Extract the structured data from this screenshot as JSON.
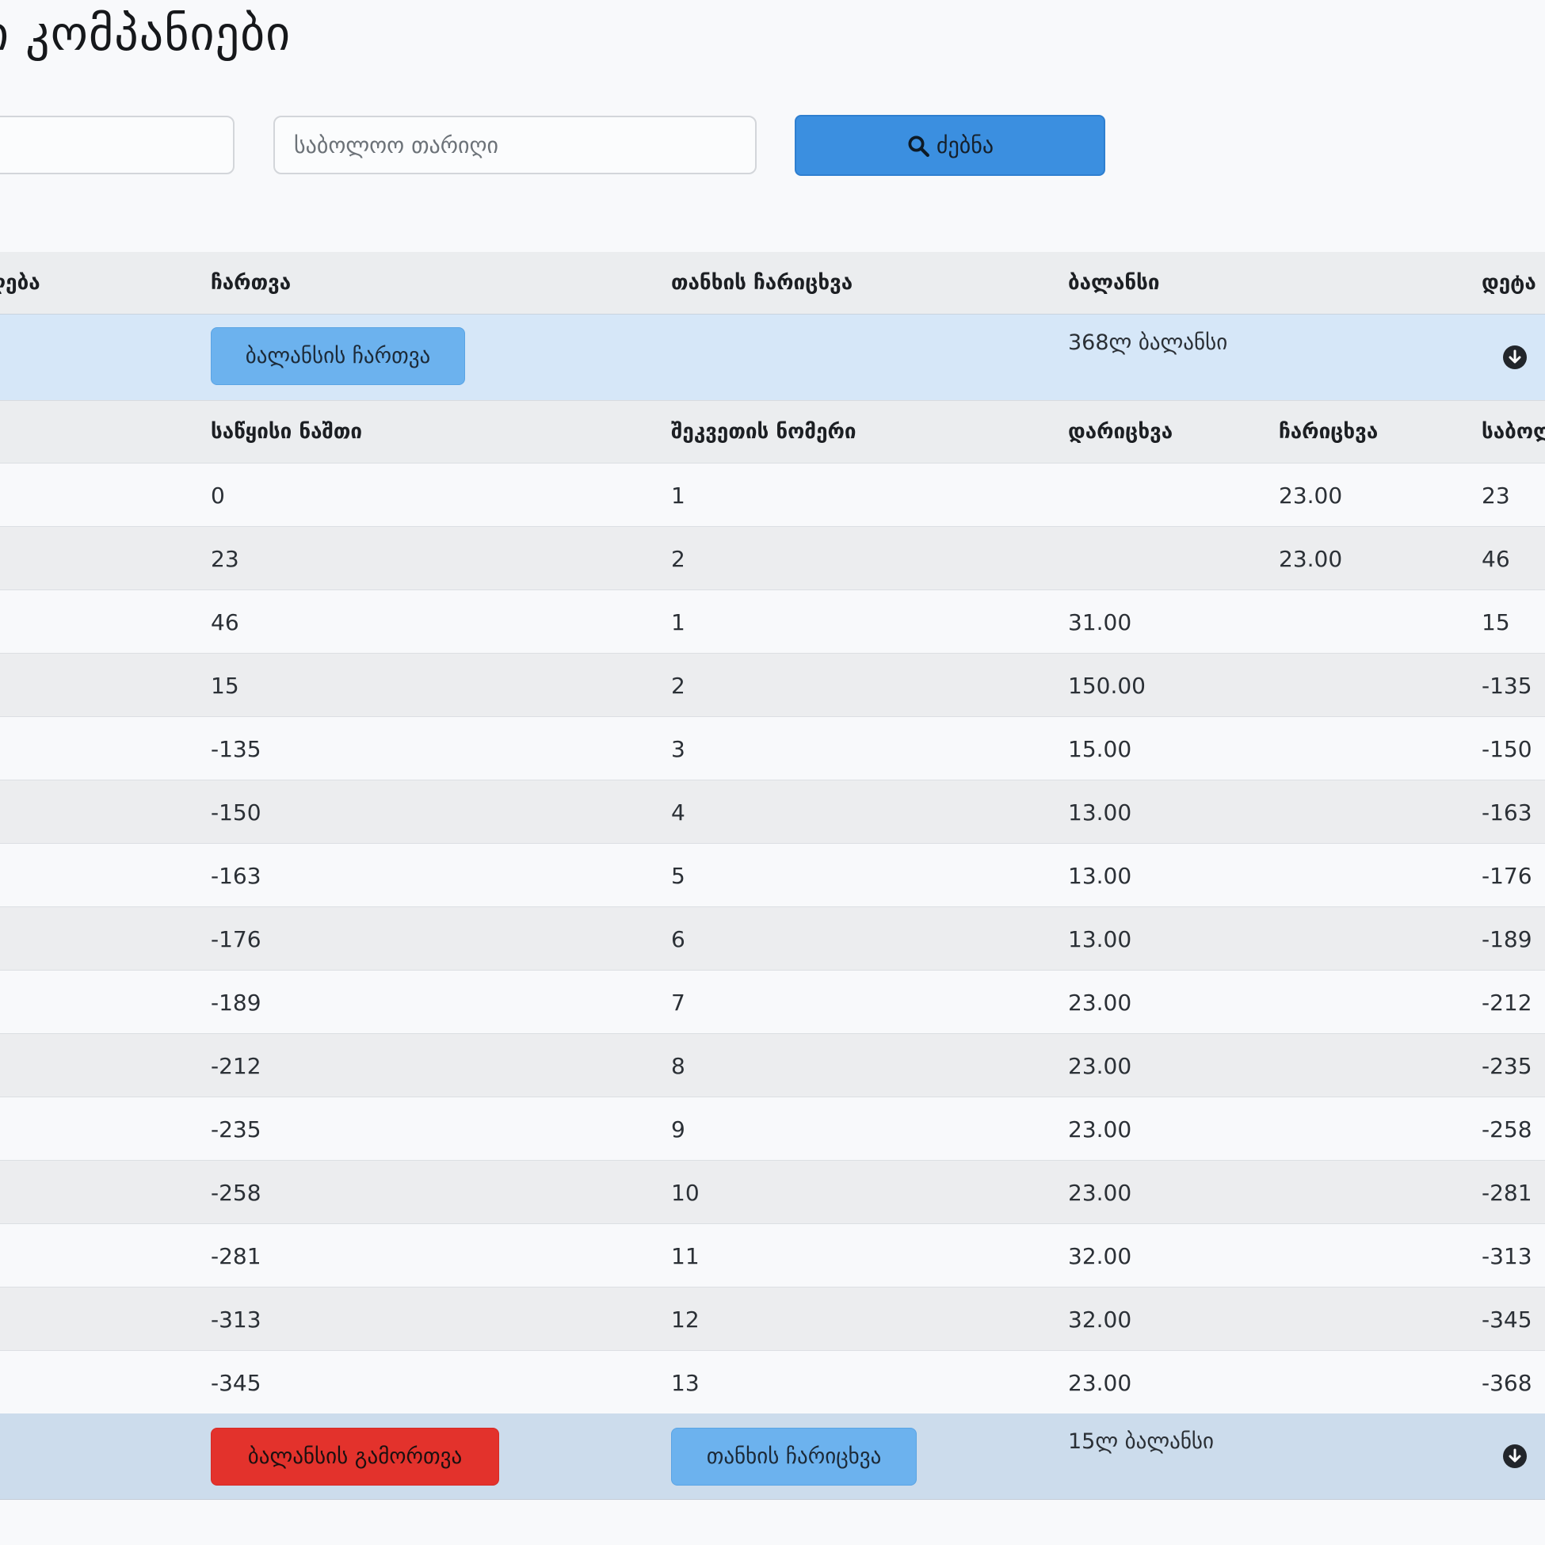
{
  "page": {
    "title": "ი კომპანიები"
  },
  "filters": {
    "start_date_value": "",
    "end_date_placeholder": "საბოლოო თარიღი",
    "search_label": "ძებნა"
  },
  "table": {
    "headers": {
      "col1": "ღება",
      "col2": "ჩართვა",
      "col3": "თანხის ჩარიცხვა",
      "col4": "ბალანსი",
      "col5": "დეტა"
    },
    "top_summary": {
      "activate_label": "ბალანსის ჩართვა",
      "balance_text": "368ლ ბალანსი"
    },
    "sub_headers": {
      "initial": "საწყისი ნაშთი",
      "order": "შეკვეთის ნომერი",
      "debit": "დარიცხვა",
      "credit": "ჩარიცხვა",
      "final": "საბოლ"
    },
    "rows": [
      {
        "initial": "0",
        "order": "1",
        "debit": "",
        "credit": "23.00",
        "final": "23"
      },
      {
        "initial": "23",
        "order": "2",
        "debit": "",
        "credit": "23.00",
        "final": "46"
      },
      {
        "initial": "46",
        "order": "1",
        "debit": "31.00",
        "credit": "",
        "final": "15"
      },
      {
        "initial": "15",
        "order": "2",
        "debit": "150.00",
        "credit": "",
        "final": "-135"
      },
      {
        "initial": "-135",
        "order": "3",
        "debit": "15.00",
        "credit": "",
        "final": "-150"
      },
      {
        "initial": "-150",
        "order": "4",
        "debit": "13.00",
        "credit": "",
        "final": "-163"
      },
      {
        "initial": "-163",
        "order": "5",
        "debit": "13.00",
        "credit": "",
        "final": "-176"
      },
      {
        "initial": "-176",
        "order": "6",
        "debit": "13.00",
        "credit": "",
        "final": "-189"
      },
      {
        "initial": "-189",
        "order": "7",
        "debit": "23.00",
        "credit": "",
        "final": "-212"
      },
      {
        "initial": "-212",
        "order": "8",
        "debit": "23.00",
        "credit": "",
        "final": "-235"
      },
      {
        "initial": "-235",
        "order": "9",
        "debit": "23.00",
        "credit": "",
        "final": "-258"
      },
      {
        "initial": "-258",
        "order": "10",
        "debit": "23.00",
        "credit": "",
        "final": "-281"
      },
      {
        "initial": "-281",
        "order": "11",
        "debit": "32.00",
        "credit": "",
        "final": "-313"
      },
      {
        "initial": "-313",
        "order": "12",
        "debit": "32.00",
        "credit": "",
        "final": "-345"
      },
      {
        "initial": "-345",
        "order": "13",
        "debit": "23.00",
        "credit": "",
        "final": "-368"
      }
    ],
    "bottom_summary": {
      "deactivate_label": "ბალანსის გამორთვა",
      "deposit_label": "თანხის ჩარიცხვა",
      "balance_text": "15ლ ბალანსი"
    }
  },
  "colors": {
    "primary": "#3b8fe0",
    "info": "#6cb2ee",
    "danger": "#e3322c"
  }
}
